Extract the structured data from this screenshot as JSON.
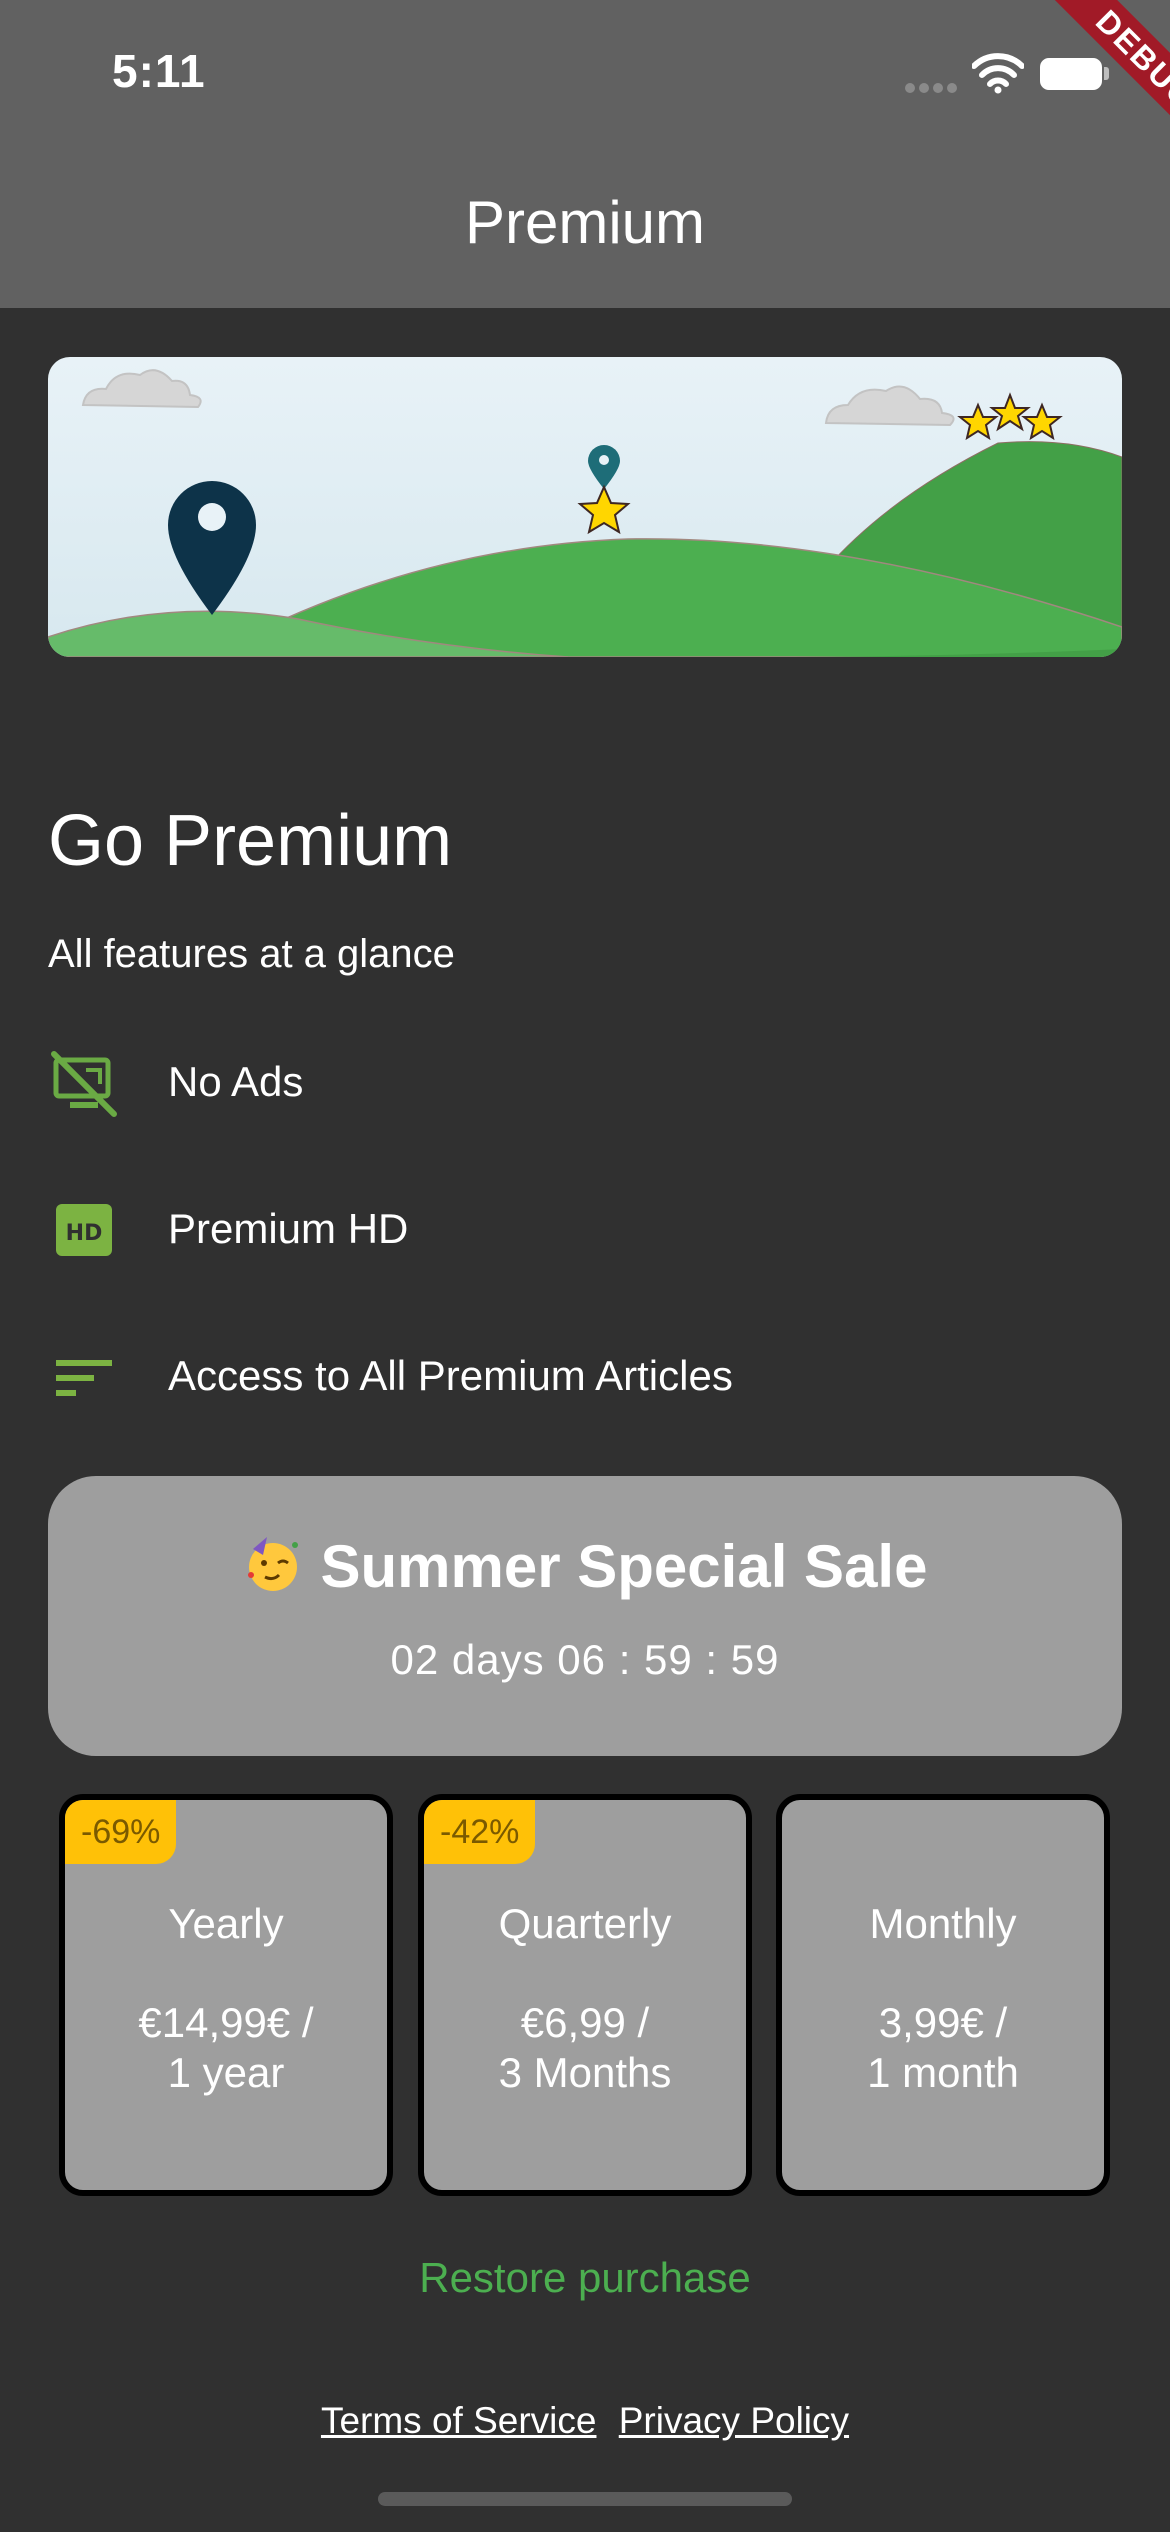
{
  "status_bar": {
    "time": "5:11"
  },
  "debug_banner": "DEBUG",
  "app_bar": {
    "title": "Premium"
  },
  "heading": {
    "title": "Go Premium",
    "subtitle": "All features at a glance"
  },
  "features": [
    {
      "icon": "no-ads-icon",
      "label": "No Ads"
    },
    {
      "icon": "hd-icon",
      "label": "Premium HD"
    },
    {
      "icon": "sort-lines-icon",
      "label": "Access to All Premium Articles"
    }
  ],
  "sale": {
    "emoji": "partying-face-icon",
    "title": "Summer Special Sale",
    "countdown": "02 days 06 : 59 : 59"
  },
  "plans": [
    {
      "name": "Yearly",
      "badge": "-69%",
      "price_line1": "€14,99€ /",
      "price_line2": "1 year"
    },
    {
      "name": "Quarterly",
      "badge": "-42%",
      "price_line1": "€6,99 /",
      "price_line2": "3 Months"
    },
    {
      "name": "Monthly",
      "badge": "",
      "price_line1": "3,99€ /",
      "price_line2": "1 month"
    }
  ],
  "restore_label": "Restore purchase",
  "legal": {
    "terms": "Terms of Service",
    "privacy": "Privacy Policy"
  },
  "colors": {
    "accent_green": "#4caf50",
    "badge_yellow": "#ffc107",
    "app_bar": "#616161",
    "background": "#303030",
    "card": "#9e9e9e"
  }
}
